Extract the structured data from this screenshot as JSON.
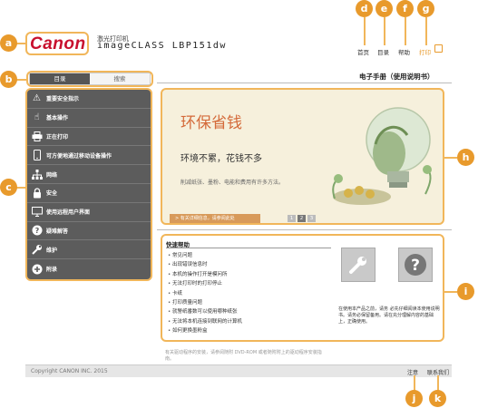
{
  "header": {
    "logo": "Canon",
    "model_small": "激光打印机",
    "model": "imageCLASS LBP151dw",
    "nav": {
      "home": "首页",
      "contents": "目录",
      "help": "帮助",
      "print": "打印"
    }
  },
  "tabs": {
    "active": "目录",
    "inactive": "搜索"
  },
  "sidebar": {
    "items": [
      {
        "label": "重要安全指示",
        "icon": "warning-icon"
      },
      {
        "label": "基本操作",
        "icon": "hand-icon"
      },
      {
        "label": "正在打印",
        "icon": "printer-icon"
      },
      {
        "label": "可方便地通过移动设备操作",
        "icon": "mobile-icon"
      },
      {
        "label": "网络",
        "icon": "network-icon"
      },
      {
        "label": "安全",
        "icon": "lock-icon"
      },
      {
        "label": "使用远程用户界面",
        "icon": "monitor-icon"
      },
      {
        "label": "疑难解答",
        "icon": "question-icon"
      },
      {
        "label": "维护",
        "icon": "wrench-icon"
      },
      {
        "label": "附录",
        "icon": "plus-icon"
      }
    ]
  },
  "manual_title": "电子手册（使用说明书）",
  "banner": {
    "title": "环保省钱",
    "subtitle": "环境不累，花钱不多",
    "desc": "削减纸张、墨粉、电能和费用有许多方法。",
    "more": "> 有关详细信息，请参阅此处",
    "pages": [
      "1",
      "2",
      "3"
    ]
  },
  "quick_help": {
    "title": "快速帮助",
    "items": [
      "常见问题",
      "出现错误信息时",
      "本机的操作打开是模问所",
      "无法打印时的打印停止",
      "卡纸",
      "打印质量问题",
      "就警纸番数可以使用哪种纸张",
      "无法将本机连接到联网的计算机",
      "如何更换墨粉盒"
    ],
    "note": "在使用本产品之前，请务 必先仔细阅读本使用说明书。请务必保留备用。请在充分理解内容的基础上，正确使用。"
  },
  "footnote": "有关驱动程序的安装，请参阅随附 DVD-ROM 或者随附附上的驱动程序安装指南。",
  "footer": {
    "copyright": "Copyright CANON INC. 2015",
    "notice": "注意",
    "contact": "联系我们"
  },
  "badges": [
    "a",
    "b",
    "c",
    "d",
    "e",
    "f",
    "g",
    "h",
    "i",
    "j",
    "k"
  ],
  "colors": {
    "accent": "#e89a2c",
    "brand": "#c8102e",
    "sidebar": "#5c5c5c",
    "banner_title": "#d46a3a"
  }
}
